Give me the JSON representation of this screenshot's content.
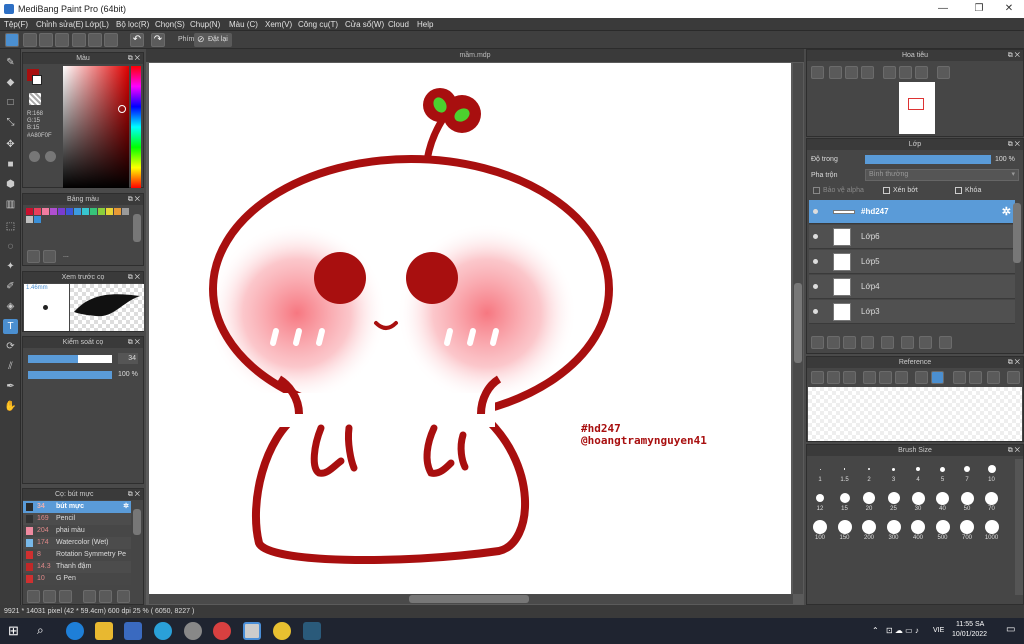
{
  "window": {
    "title": "MediBang Paint Pro (64bit)"
  },
  "menu": [
    "Tệp(F)",
    "Chỉnh sửa(E)",
    "Lớp(L)",
    "Bộ lọc(R)",
    "Chọn(S)",
    "Chụp(N)",
    "Màu (C)",
    "Xem(V)",
    "Công cụ(T)",
    "Cửa sổ(W)",
    "Cloud",
    "Help"
  ],
  "toolbar": {
    "phim_label": "Phím",
    "reset_label": "Đặt lại"
  },
  "color_panel": {
    "title": "Màu",
    "r": "R:168",
    "g": "G:15",
    "b": "B:15",
    "hex": "#A80F0F",
    "primary_color": "#a80f0f",
    "secondary_color": "#ffffff"
  },
  "palette_panel": {
    "title": "Bảng màu",
    "more": "...",
    "swatches": [
      "#c8102e",
      "#e83e5c",
      "#f07ca0",
      "#b04fd0",
      "#7a3cd0",
      "#3c56d8",
      "#3c9be0",
      "#37c6d0",
      "#36c47a",
      "#8bcf3c",
      "#e8d436",
      "#e89a36",
      "#9a9a9a",
      "#c0c0c0",
      "#3a8fd8"
    ]
  },
  "brush_preview": {
    "title": "Xem trước cọ",
    "size": "1.46mm"
  },
  "brush_control": {
    "title": "Kiểm soát cọ",
    "size_value": "34",
    "opacity_value": "100 %",
    "size_level": 0.6,
    "opacity_level": 1.0
  },
  "brush_list": {
    "title": "Cọ: bút mực",
    "items": [
      {
        "size": "34",
        "name": "bút mực",
        "color": "#2b2b2b",
        "selected": true
      },
      {
        "size": "169",
        "name": "Pencil",
        "color": "#333333",
        "selected": false
      },
      {
        "size": "204",
        "name": "phai màu",
        "color": "#f08aa0",
        "selected": false
      },
      {
        "size": "174",
        "name": "Watercolor (Wet)",
        "color": "#78b8e8",
        "selected": false
      },
      {
        "size": "8",
        "name": "Rotation Symmetry Pe",
        "color": "#d03030",
        "selected": false
      },
      {
        "size": "14.3",
        "name": "Thanh đậm",
        "color": "#c02828",
        "selected": false
      },
      {
        "size": "10",
        "name": "G Pen",
        "color": "#d03030",
        "selected": false
      }
    ]
  },
  "document": {
    "tab": "mầm.mdp",
    "signature_line1": "#hd247",
    "signature_line2": "@hoangtramynguyen41"
  },
  "navigator": {
    "title": "Hoa tiêu"
  },
  "layer_panel": {
    "title": "Lớp",
    "opacity_label": "Độ trong",
    "opacity_value": "100 %",
    "blend_label": "Pha trộn",
    "blend_value": "Bình thường",
    "protect_alpha": "Bảo vệ alpha",
    "clip": "Xén bớt",
    "lock": "Khóa",
    "layers": [
      {
        "name": "#hd247",
        "selected": true
      },
      {
        "name": "Lớp6",
        "selected": false
      },
      {
        "name": "Lớp5",
        "selected": false
      },
      {
        "name": "Lớp4",
        "selected": false
      },
      {
        "name": "Lớp3",
        "selected": false
      }
    ]
  },
  "reference_panel": {
    "title": "Reference"
  },
  "brush_size_panel": {
    "title": "Brush Size",
    "sizes": [
      "1",
      "1.5",
      "2",
      "3",
      "4",
      "5",
      "7",
      "10",
      "12",
      "15",
      "20",
      "25",
      "30",
      "40",
      "50",
      "70",
      "100",
      "150",
      "200",
      "300",
      "400",
      "500",
      "700",
      "1000"
    ]
  },
  "status": {
    "text": "9921 * 14031 pixel  (42 * 59.4cm)  600 dpi  25 %  ( 6050, 8227 )"
  },
  "taskbar": {
    "lang": "VIE",
    "time": "11:55 SA",
    "date": "10/01/2022"
  }
}
